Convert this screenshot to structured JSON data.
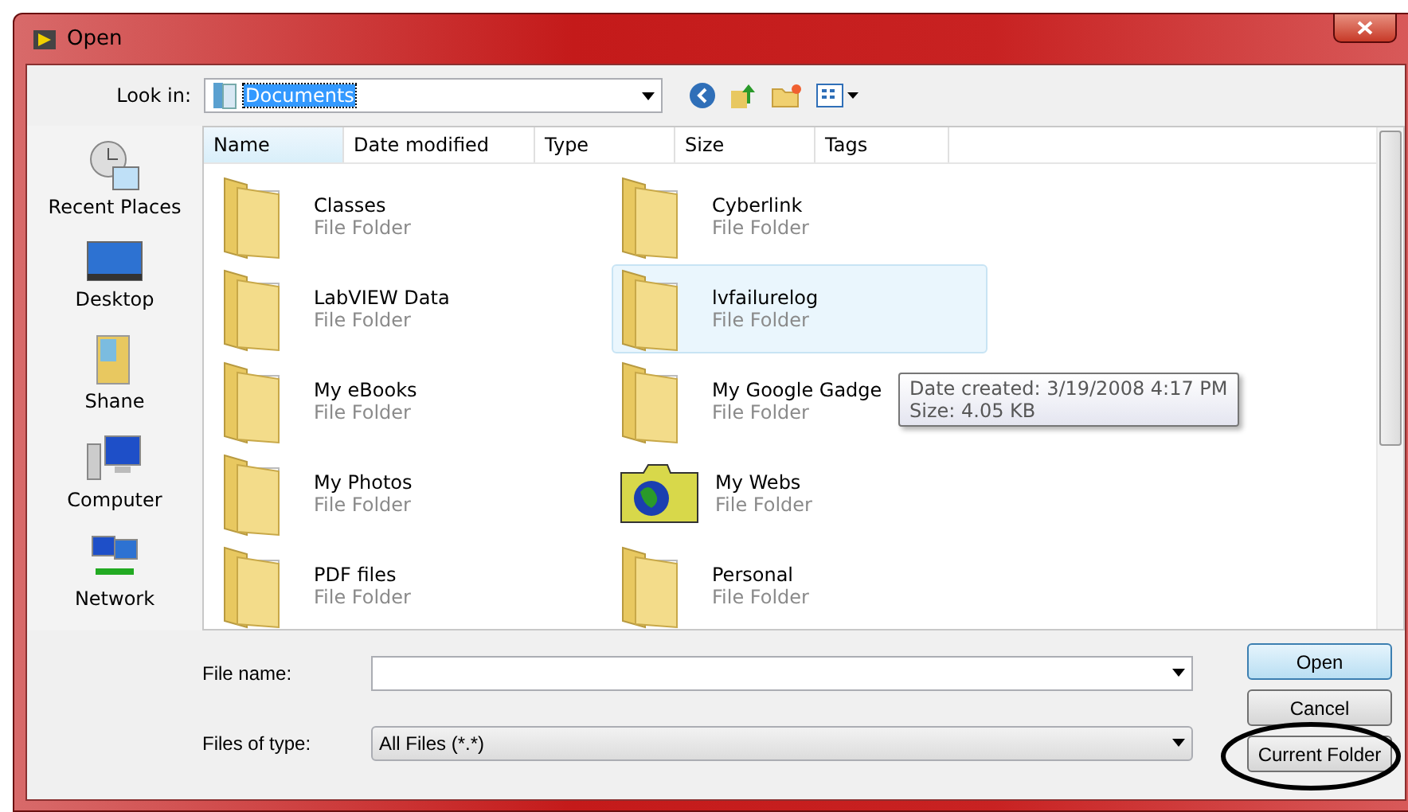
{
  "window": {
    "title": "Open"
  },
  "look_in": {
    "label": "Look in:",
    "value": "Documents"
  },
  "places": [
    {
      "label": "Recent Places",
      "kind": "recent"
    },
    {
      "label": "Desktop",
      "kind": "desktop"
    },
    {
      "label": "Shane",
      "kind": "user"
    },
    {
      "label": "Computer",
      "kind": "computer"
    },
    {
      "label": "Network",
      "kind": "network"
    }
  ],
  "columns": [
    {
      "label": "Name",
      "selected": true
    },
    {
      "label": "Date modified",
      "selected": false
    },
    {
      "label": "Type",
      "selected": false
    },
    {
      "label": "Size",
      "selected": false
    },
    {
      "label": "Tags",
      "selected": false
    }
  ],
  "items": [
    {
      "name": "Classes",
      "type": "File Folder",
      "kind": "folder",
      "selected": false
    },
    {
      "name": "Cyberlink",
      "type": "File Folder",
      "kind": "folder",
      "selected": false
    },
    {
      "name": "LabVIEW Data",
      "type": "File Folder",
      "kind": "folder",
      "selected": false
    },
    {
      "name": "lvfailurelog",
      "type": "File Folder",
      "kind": "folder",
      "selected": true
    },
    {
      "name": "My eBooks",
      "type": "File Folder",
      "kind": "folder",
      "selected": false
    },
    {
      "name": "My Google Gadge",
      "type": "File Folder",
      "kind": "folder",
      "selected": false
    },
    {
      "name": "My Photos",
      "type": "File Folder",
      "kind": "folder",
      "selected": false
    },
    {
      "name": "My Webs",
      "type": "File Folder",
      "kind": "web",
      "selected": false
    },
    {
      "name": "PDF files",
      "type": "File Folder",
      "kind": "folder",
      "selected": false
    },
    {
      "name": "Personal",
      "type": "File Folder",
      "kind": "folder",
      "selected": false
    }
  ],
  "tooltip": [
    "Date created: 3/19/2008 4:17 PM",
    "Size: 4.05 KB"
  ],
  "file_name": {
    "label": "File name:"
  },
  "file_type": {
    "label": "Files of type:",
    "value": "All Files (*.*)"
  },
  "buttons": [
    {
      "label": "Open",
      "default": true
    },
    {
      "label": "Cancel",
      "default": false
    },
    {
      "label": "Current Folder",
      "default": false
    }
  ]
}
